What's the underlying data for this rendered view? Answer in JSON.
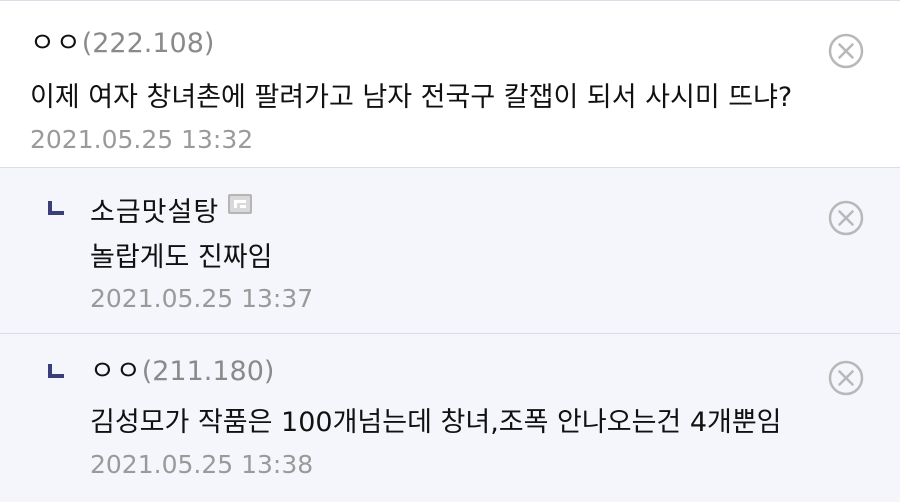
{
  "comments": [
    {
      "author": "ㅇㅇ",
      "ip": "(222.108)",
      "text": "이제 여자 창녀촌에 팔려가고 남자 전국구 칼잽이 되서 사시미 뜨냐?",
      "date": "2021.05.25 13:32"
    },
    {
      "author": "소금맛설탕",
      "text": "놀랍게도 진짜임",
      "date": "2021.05.25 13:37",
      "badge_icon": "fixed-nick-badge-icon"
    },
    {
      "author": "ㅇㅇ",
      "ip": "(211.180)",
      "text": "김성모가 작품은 100개넘는데 창녀,조폭 안나오는건 4개뿐임",
      "date": "2021.05.25 13:38"
    }
  ],
  "colors": {
    "reply_background": "#f5f6fb",
    "reply_marker": "#3a3e7a",
    "divider": "#dcdde6",
    "ip_text": "#8a8a8a",
    "date_text": "#9a9a9a",
    "delete_icon": "#b8b8b8"
  }
}
